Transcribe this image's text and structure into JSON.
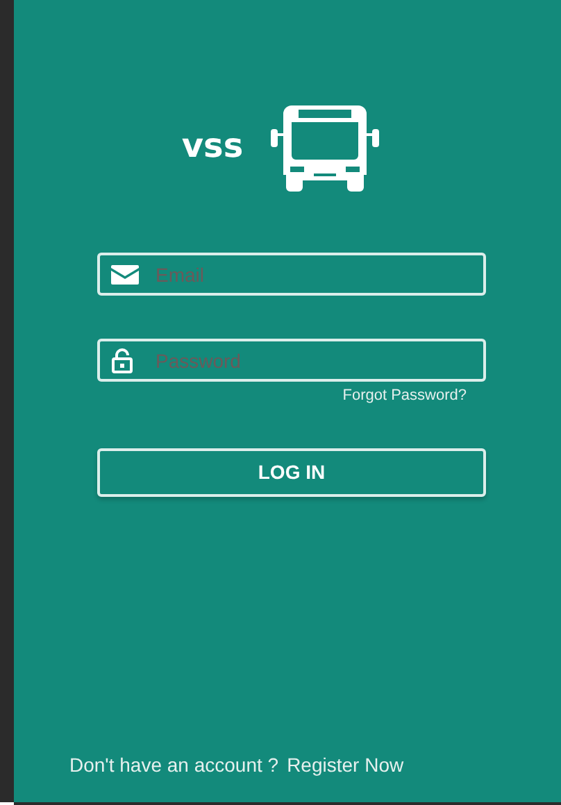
{
  "logo": {
    "text": "vss"
  },
  "fields": [
    {
      "kind": "email",
      "placeholder": "Email"
    },
    {
      "kind": "password",
      "placeholder": "Password"
    }
  ],
  "forgot_link": "Forgot Password?",
  "login_button": "LOG IN",
  "footer": {
    "prompt": "Don't have an account ?",
    "link": "Register Now"
  }
}
